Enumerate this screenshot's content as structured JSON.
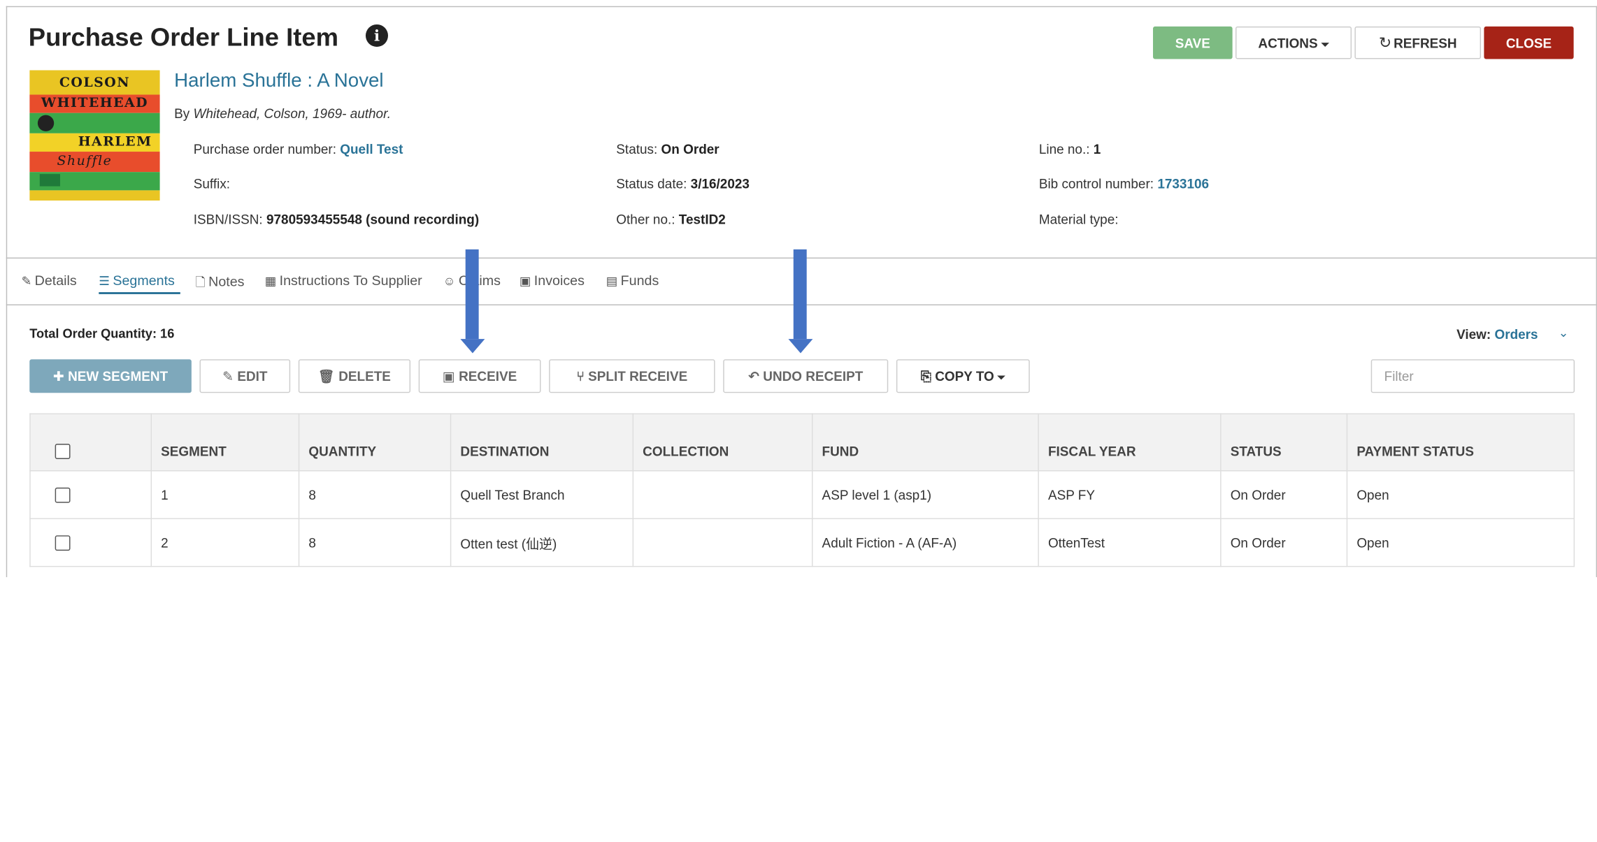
{
  "header": {
    "title": "Purchase Order Line Item",
    "info_icon": "info-circle-icon",
    "buttons": {
      "save": "SAVE",
      "actions": "ACTIONS",
      "refresh": "REFRESH",
      "close": "CLOSE"
    },
    "colors": {
      "save": "#7dbb82",
      "close": "#a62317",
      "link": "#2a7397"
    }
  },
  "item": {
    "cover_lines": [
      "COLSON",
      "WHITEHEAD",
      "HARLEM",
      "Shuffle"
    ],
    "title": "Harlem Shuffle : A Novel",
    "author_prefix": "By",
    "author": "Whitehead, Colson, 1969- author."
  },
  "meta": {
    "po_number_label": "Purchase order number:",
    "po_number": "Quell Test",
    "suffix_label": "Suffix:",
    "isbn_label": "ISBN/ISSN:",
    "isbn": "9780593455548 (sound recording)",
    "status_label": "Status:",
    "status": "On Order",
    "status_date_label": "Status date:",
    "status_date": "3/16/2023",
    "other_no_label": "Other no.:",
    "other_no": "TestID2",
    "line_no_label": "Line no.:",
    "line_no": "1",
    "bib_label": "Bib control number:",
    "bib": "1733106",
    "material_label": "Material type:"
  },
  "tabs": [
    {
      "label": "Details",
      "icon": "edit-icon"
    },
    {
      "label": "Segments",
      "icon": "list-icon",
      "active": true
    },
    {
      "label": "Notes",
      "icon": "file-icon"
    },
    {
      "label": "Instructions To Supplier",
      "icon": "building-icon"
    },
    {
      "label": "Claims",
      "icon": "smile-icon"
    },
    {
      "label": "Invoices",
      "icon": "money-icon"
    },
    {
      "label": "Funds",
      "icon": "bank-icon"
    }
  ],
  "segments": {
    "total_label": "Total Order Quantity: 16",
    "view_label": "View:",
    "view_value": "Orders",
    "buttons": {
      "new": "NEW SEGMENT",
      "edit": "EDIT",
      "delete": "DELETE",
      "receive": "RECEIVE",
      "split": "SPLIT RECEIVE",
      "undo": "UNDO RECEIPT",
      "copy": "COPY TO"
    },
    "filter_placeholder": "Filter",
    "columns": [
      "SEGMENT",
      "QUANTITY",
      "DESTINATION",
      "COLLECTION",
      "FUND",
      "FISCAL YEAR",
      "STATUS",
      "PAYMENT STATUS"
    ],
    "rows": [
      [
        "1",
        "8",
        "Quell Test Branch",
        "",
        "ASP level 1 (asp1)",
        "ASP FY",
        "On Order",
        "Open"
      ],
      [
        "2",
        "8",
        "Otten test (仙逆)",
        "",
        "Adult Fiction - A (AF-A)",
        "OttenTest",
        "On Order",
        "Open"
      ]
    ]
  },
  "annotation_color": "#4472c4"
}
